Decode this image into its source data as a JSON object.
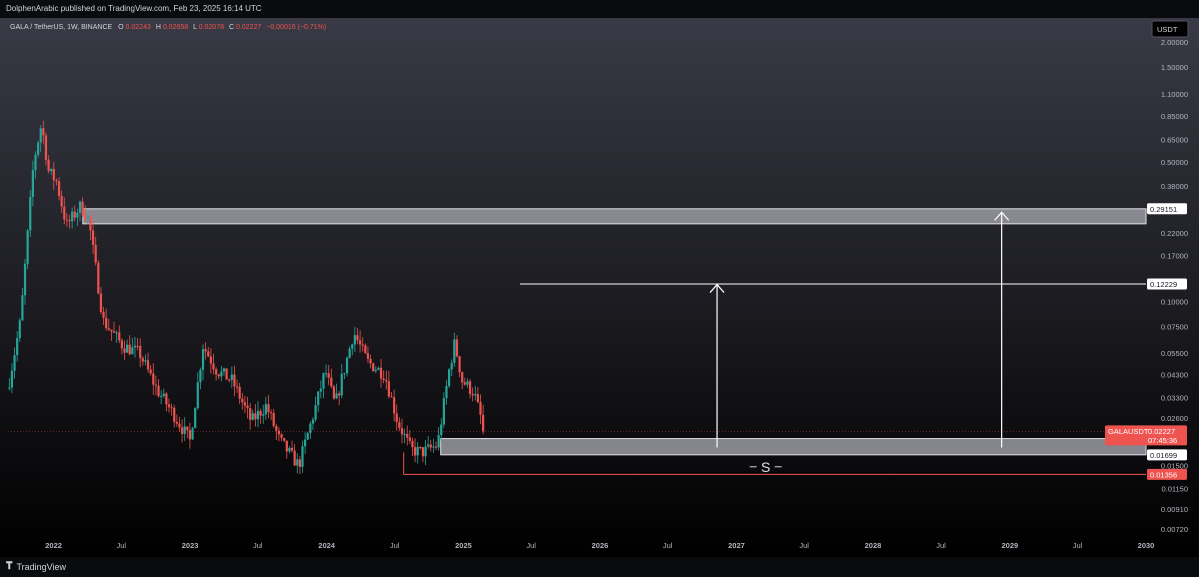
{
  "header": {
    "published_text": "DolphenArabic published on TradingView.com, Feb 23, 2025 16:14 UTC"
  },
  "footer": {
    "brand_name": "TradingView",
    "logo_glyph": "𝐓"
  },
  "legend": {
    "symbol": "GALA / TetherUS, 1W, BINANCE",
    "open_label": "O",
    "open": "0.02243",
    "high_label": "H",
    "high": "0.02658",
    "low_label": "L",
    "low": "0.02078",
    "close_label": "C",
    "close": "0.02227",
    "change": "−0.00016 (−0.71%)"
  },
  "colors": {
    "up": "#26a69a",
    "down": "#ef5350",
    "zone_fill": "#9a9ba3",
    "line": "#ffffff",
    "support_line": "#ef5350",
    "bg_top": "#3a3a46",
    "bg_bottom": "#000000"
  },
  "chart_data": {
    "type": "candlestick",
    "y_scale": "log",
    "currency": "USDT",
    "ylim": [
      0.0065,
      2.3
    ],
    "xlim": [
      "2021-09-01",
      "2029-12-31"
    ],
    "y_ticks": [
      "2.00000",
      "1.50000",
      "1.10000",
      "0.85000",
      "0.65000",
      "0.50000",
      "0.38000",
      "0.29151",
      "0.22000",
      "0.17000",
      "0.12229",
      "0.10000",
      "0.07500",
      "0.05500",
      "0.04300",
      "0.03300",
      "0.02600",
      "0.01699",
      "0.01500",
      "0.01356",
      "0.01150",
      "0.00910",
      "0.00720"
    ],
    "x_ticks": [
      {
        "label": "2022",
        "date": "2022-01-01"
      },
      {
        "label": "Jul",
        "date": "2022-07-01"
      },
      {
        "label": "2023",
        "date": "2023-01-01"
      },
      {
        "label": "Jul",
        "date": "2023-07-01"
      },
      {
        "label": "2024",
        "date": "2024-01-01"
      },
      {
        "label": "Jul",
        "date": "2024-07-01"
      },
      {
        "label": "2025",
        "date": "2025-01-01"
      },
      {
        "label": "Jul",
        "date": "2025-07-01"
      },
      {
        "label": "2026",
        "date": "2026-01-01"
      },
      {
        "label": "Jul",
        "date": "2026-07-01"
      },
      {
        "label": "2027",
        "date": "2027-01-01"
      },
      {
        "label": "Jul",
        "date": "2027-07-01"
      },
      {
        "label": "2028",
        "date": "2028-01-01"
      },
      {
        "label": "Jul",
        "date": "2028-07-01"
      },
      {
        "label": "2029",
        "date": "2029-01-01"
      },
      {
        "label": "Jul",
        "date": "2029-07-01"
      },
      {
        "label": "2030",
        "date": "2029-12-31"
      }
    ],
    "price_path": [
      [
        "2021-09-01",
        0.04
      ],
      [
        "2021-10-01",
        0.08
      ],
      [
        "2021-11-05",
        0.5
      ],
      [
        "2021-11-26",
        0.78
      ],
      [
        "2021-12-15",
        0.45
      ],
      [
        "2022-01-05",
        0.4
      ],
      [
        "2022-02-01",
        0.24
      ],
      [
        "2022-03-10",
        0.3
      ],
      [
        "2022-04-01",
        0.26
      ],
      [
        "2022-05-10",
        0.08
      ],
      [
        "2022-07-01",
        0.06
      ],
      [
        "2022-08-15",
        0.055
      ],
      [
        "2022-10-01",
        0.036
      ],
      [
        "2022-11-15",
        0.027
      ],
      [
        "2022-12-28",
        0.02
      ],
      [
        "2023-02-01",
        0.06
      ],
      [
        "2023-03-10",
        0.045
      ],
      [
        "2023-04-20",
        0.04
      ],
      [
        "2023-06-10",
        0.025
      ],
      [
        "2023-07-20",
        0.03
      ],
      [
        "2023-08-25",
        0.02
      ],
      [
        "2023-10-15",
        0.015
      ],
      [
        "2023-11-30",
        0.03
      ],
      [
        "2023-12-25",
        0.045
      ],
      [
        "2024-01-20",
        0.03
      ],
      [
        "2024-03-10",
        0.07
      ],
      [
        "2024-04-15",
        0.05
      ],
      [
        "2024-06-01",
        0.043
      ],
      [
        "2024-07-05",
        0.025
      ],
      [
        "2024-08-10",
        0.018
      ],
      [
        "2024-09-10",
        0.0175
      ],
      [
        "2024-10-20",
        0.019
      ],
      [
        "2024-11-20",
        0.045
      ],
      [
        "2024-12-05",
        0.062
      ],
      [
        "2024-12-25",
        0.04
      ],
      [
        "2025-01-25",
        0.035
      ],
      [
        "2025-02-23",
        0.02227
      ]
    ],
    "resistance_zone": {
      "top": 0.29151,
      "bottom": 0.245,
      "start": "2022-03-20",
      "end": "2029-12-31"
    },
    "support_zone": {
      "top": 0.0205,
      "bottom": 0.01699,
      "start": "2024-11-01",
      "end": "2029-12-31"
    },
    "target_line": {
      "value": 0.12229,
      "start": "2025-06-01",
      "end": "2029-12-31"
    },
    "support_line": {
      "value": 0.01356,
      "start": "2024-07-25",
      "end": "2029-12-31"
    },
    "arrows": [
      {
        "date": "2026-11-10",
        "from": 0.0185,
        "to": 0.1215
      },
      {
        "date": "2028-12-10",
        "from": 0.0185,
        "to": 0.28
      }
    ],
    "support_marker": {
      "text": "S",
      "date": "2027-03-20",
      "value": 0.0148
    },
    "price_tags": [
      {
        "value": 0.29151,
        "text": "0.29151",
        "style": "white"
      },
      {
        "value": 0.12229,
        "text": "0.12229",
        "style": "white"
      },
      {
        "value": 0.02227,
        "text": "GALAUSDT",
        "subtext": "07:45:36",
        "style": "red"
      },
      {
        "value": 0.01699,
        "text": "0.01699",
        "style": "white"
      },
      {
        "value": 0.01356,
        "text": "0.01356",
        "style": "red"
      }
    ]
  }
}
